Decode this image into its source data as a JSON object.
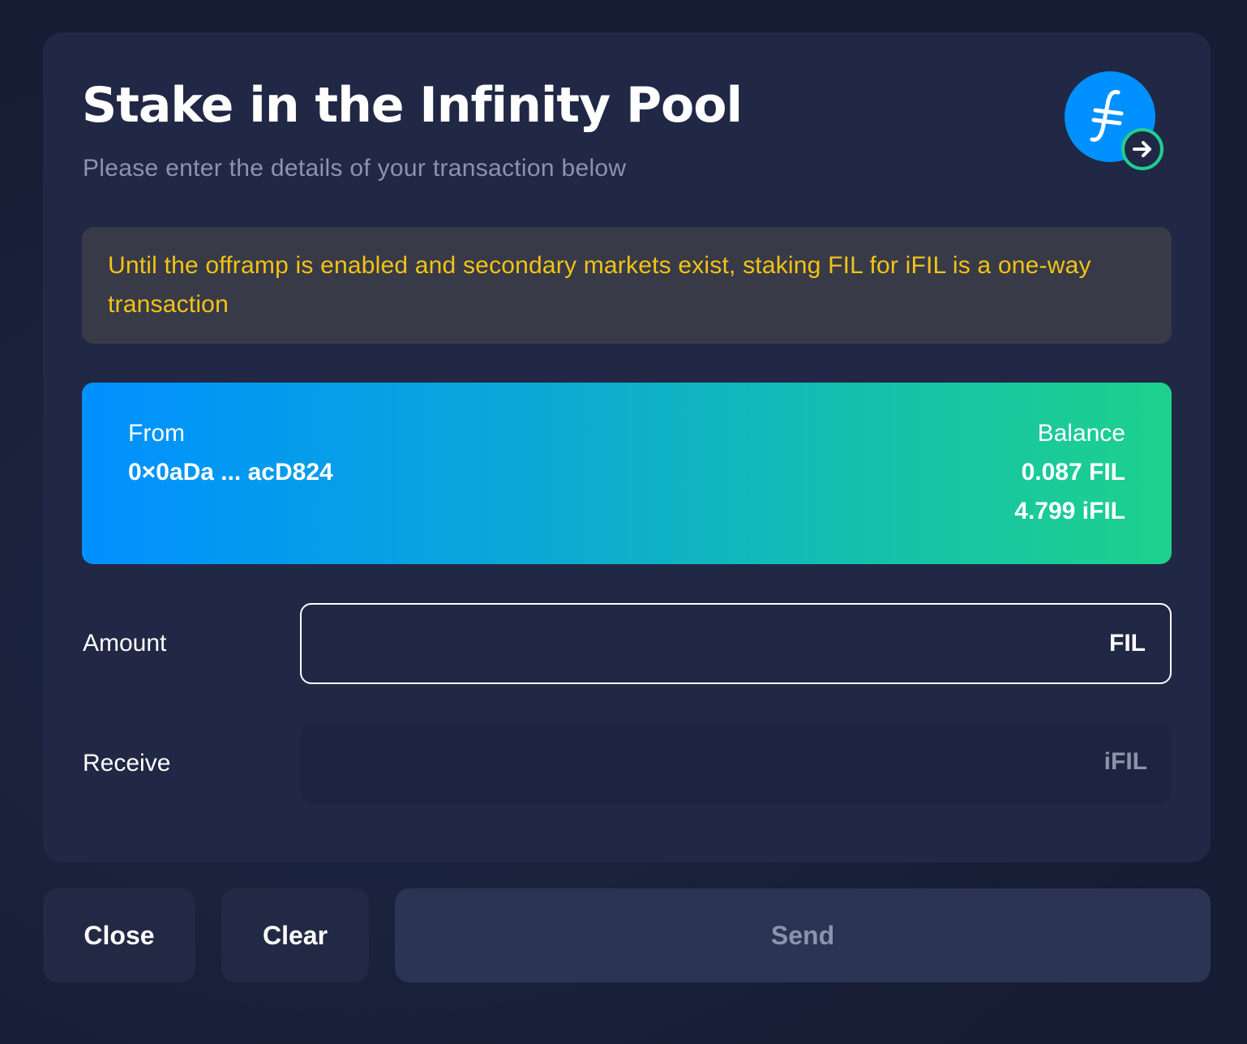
{
  "modal": {
    "title": "Stake in the Infinity Pool",
    "subtitle": "Please enter the details of your transaction below",
    "logo_icon": "filecoin-arrow-icon"
  },
  "warning": {
    "text": "Until the offramp is enabled and secondary markets exist, staking FIL for iFIL is a one-way transaction",
    "color": "#f2c314"
  },
  "wallet": {
    "from_label": "From",
    "address": "0×0aDa ... acD824",
    "balance_label": "Balance",
    "balance_fil": "0.087 FIL",
    "balance_ifil": "4.799 iFIL",
    "gradient_start": "#0090ff",
    "gradient_end": "#1dd18c"
  },
  "form": {
    "amount_label": "Amount",
    "amount_value": "",
    "amount_unit": "FIL",
    "receive_label": "Receive",
    "receive_unit": "iFIL"
  },
  "buttons": {
    "close": "Close",
    "clear": "Clear",
    "send": "Send"
  }
}
